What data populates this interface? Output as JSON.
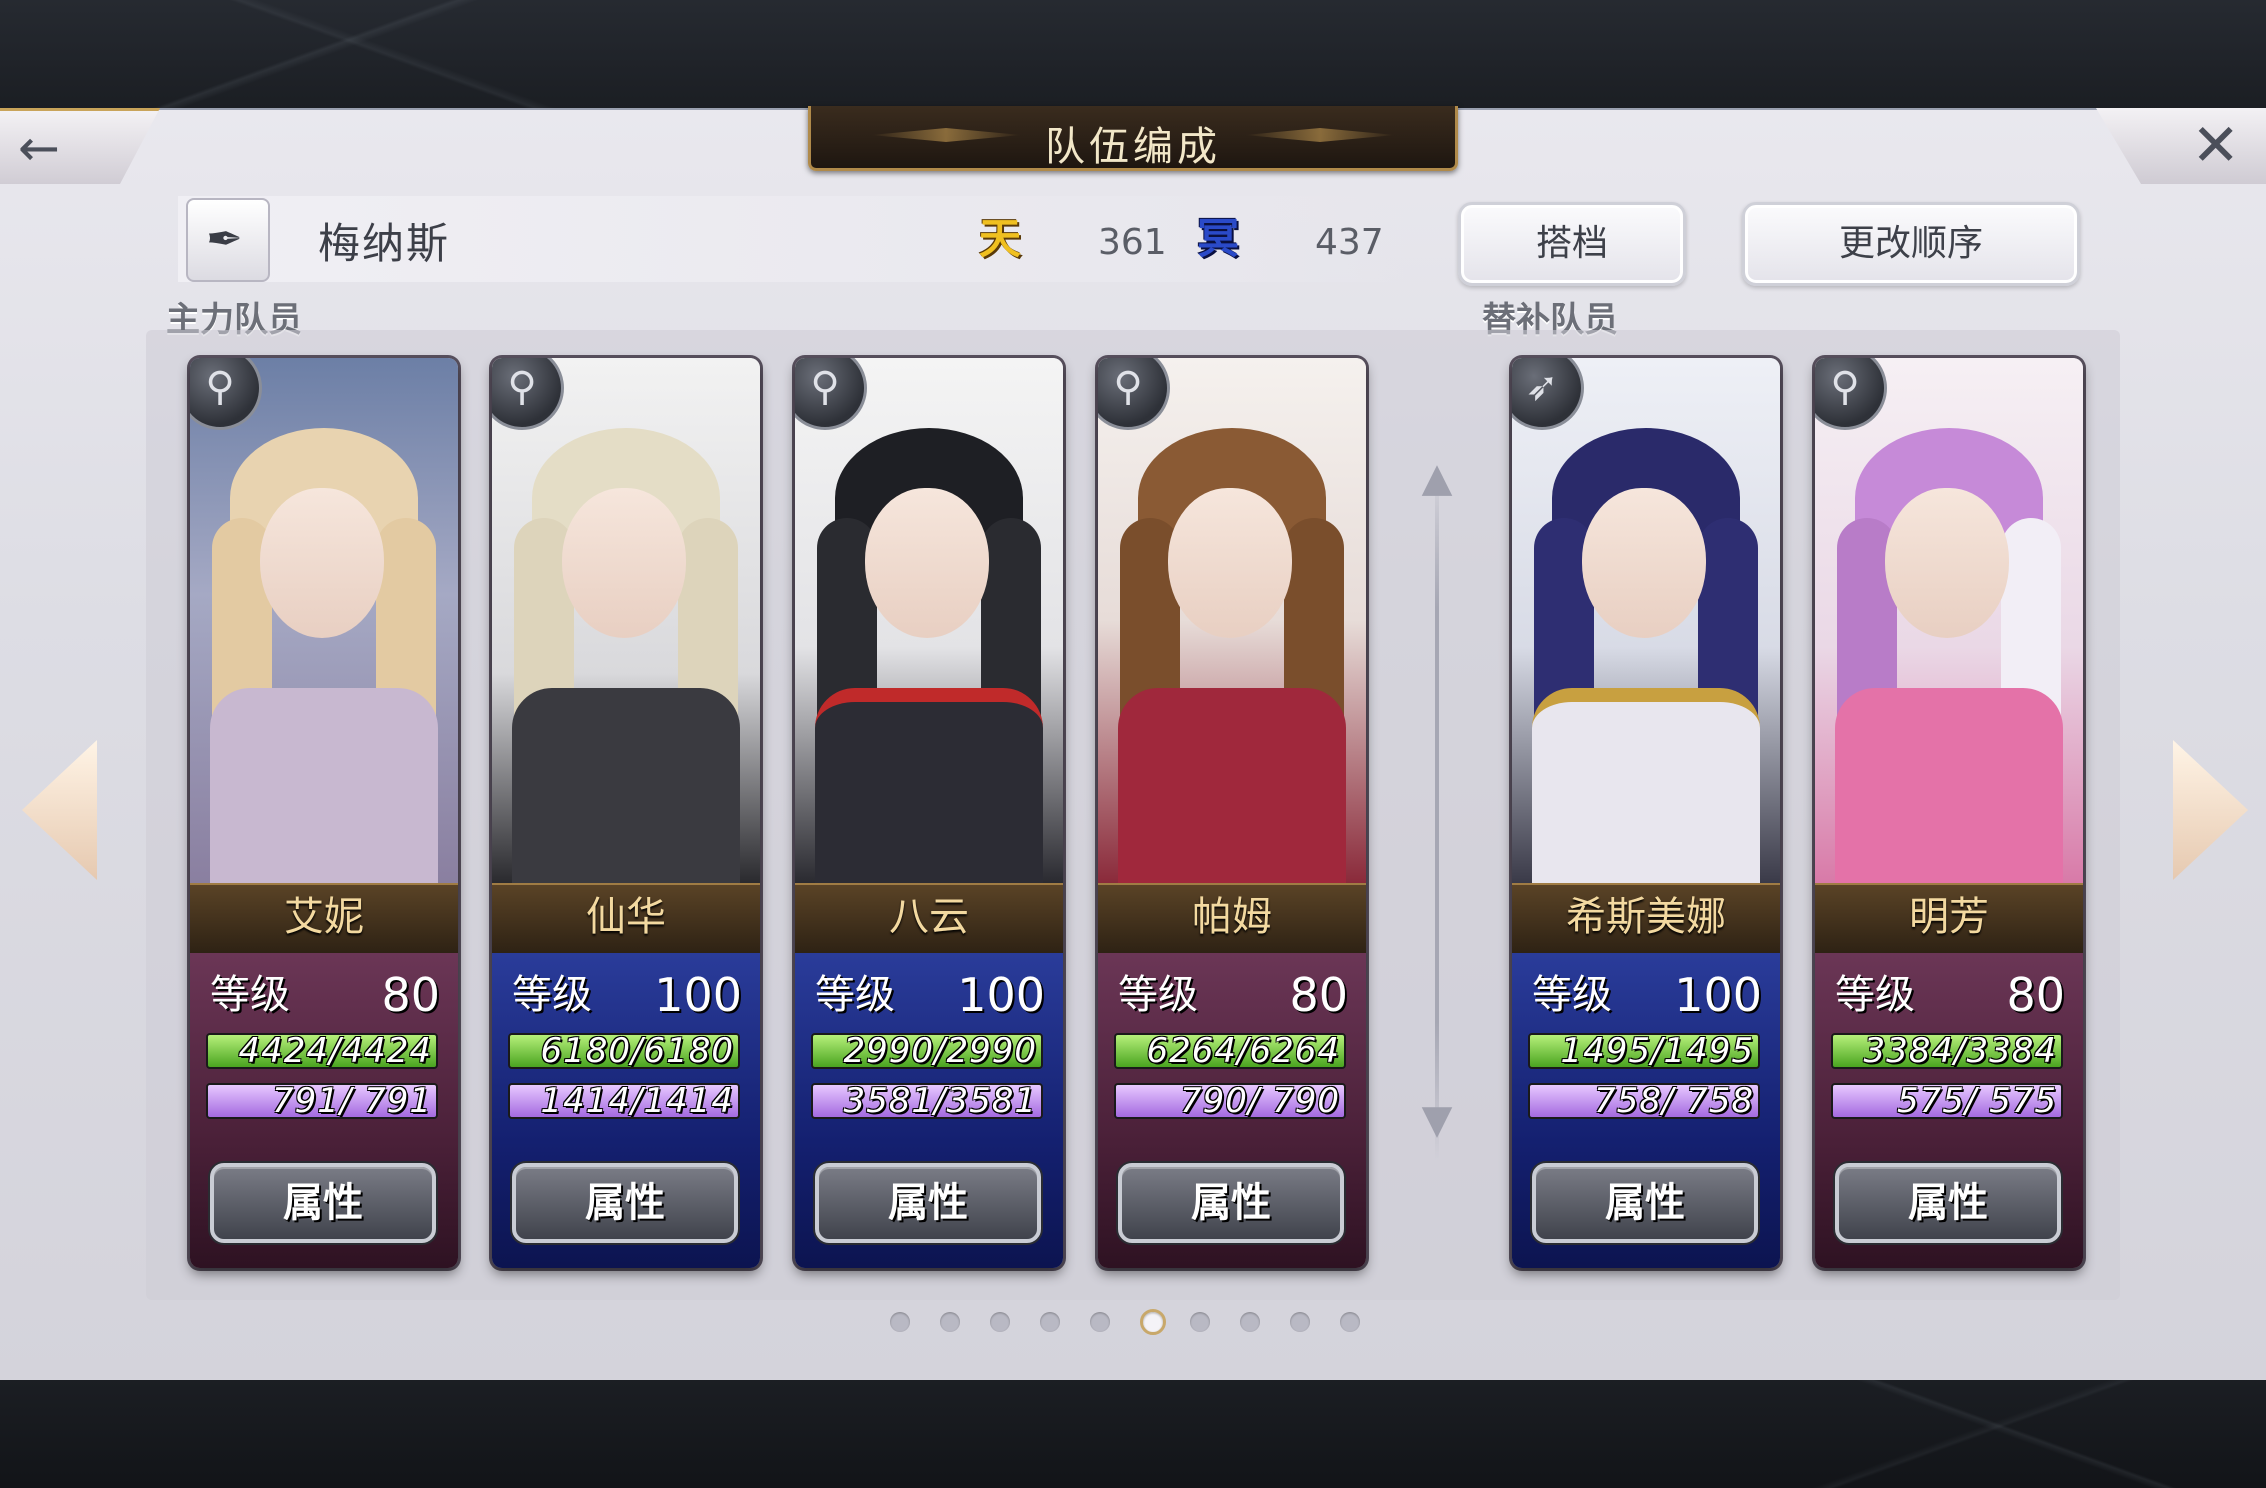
{
  "header": {
    "title": "队伍编成"
  },
  "team": {
    "name": "梅纳斯",
    "sky_icon_char": "天",
    "sky_value": "361",
    "nether_icon_char": "冥",
    "nether_value": "437"
  },
  "buttons": {
    "partner": "搭档",
    "reorder": "更改顺序",
    "attributes": "属性"
  },
  "sections": {
    "main": "主力队员",
    "sub": "替补队员"
  },
  "level_label": "等级",
  "members": [
    {
      "name": "艾妮",
      "level": "80",
      "hp": "4424/4424",
      "mp": "791/ 791",
      "role_icon": "staff-icon",
      "hp_fill": 1.0,
      "mp_fill": 1.0,
      "theme": "purple"
    },
    {
      "name": "仙华",
      "level": "100",
      "hp": "6180/6180",
      "mp": "1414/1414",
      "role_icon": "staff-icon",
      "hp_fill": 1.0,
      "mp_fill": 1.0,
      "theme": "blue"
    },
    {
      "name": "八云",
      "level": "100",
      "hp": "2990/2990",
      "mp": "3581/3581",
      "role_icon": "staff-icon",
      "hp_fill": 1.0,
      "mp_fill": 1.0,
      "theme": "blue"
    },
    {
      "name": "帕姆",
      "level": "80",
      "hp": "6264/6264",
      "mp": "790/ 790",
      "role_icon": "staff-icon",
      "hp_fill": 1.0,
      "mp_fill": 1.0,
      "theme": "purple"
    }
  ],
  "substitutes": [
    {
      "name": "希斯美娜",
      "level": "100",
      "hp": "1495/1495",
      "mp": "758/ 758",
      "role_icon": "spear-icon",
      "hp_fill": 1.0,
      "mp_fill": 1.0,
      "theme": "blue"
    },
    {
      "name": "明芳",
      "level": "80",
      "hp": "3384/3384",
      "mp": "575/ 575",
      "role_icon": "staff-icon",
      "hp_fill": 1.0,
      "mp_fill": 1.0,
      "theme": "purple"
    }
  ],
  "pagination": {
    "total": 10,
    "current": 6
  },
  "colors": {
    "gold_accent": "#b08a4a",
    "hp_green": "#4aa420",
    "mp_purple": "#a46ae0",
    "blue_card": "#2a3c9a",
    "purple_card": "#6b3656"
  }
}
